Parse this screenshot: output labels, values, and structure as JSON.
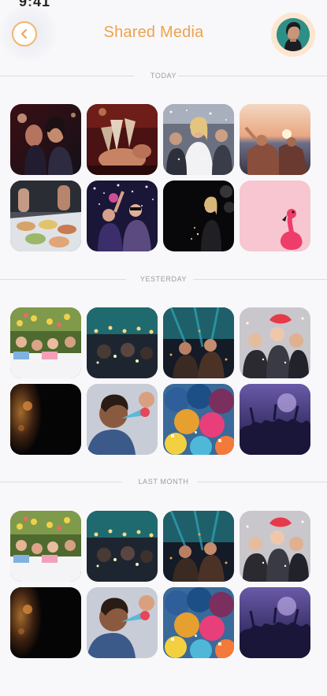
{
  "status": {
    "fragment": "9:41"
  },
  "header": {
    "title": "Shared Media",
    "back_icon": "chevron-left-icon",
    "avatar": "user-avatar",
    "accent": "#f0a24a"
  },
  "sections": [
    {
      "label": "TODAY",
      "photos": [
        "friends-toasting-night",
        "champagne-cheers",
        "crowd-dancing-confetti",
        "sunset-beach-party",
        "buffet-food-table",
        "party-lights-dancers",
        "woman-with-balloons",
        "pink-flamingo-float"
      ]
    },
    {
      "label": "YESTERDAY",
      "photos": [
        "kids-birthday-table",
        "string-lights-crowd",
        "confetti-party-friends",
        "group-selfie-confetti",
        "dark-party-closeup",
        "boy-blowing-party-horn",
        "colorful-balloons",
        "concert-crowd-purple"
      ]
    },
    {
      "label": "LAST MONTH",
      "photos": [
        "kids-birthday-table",
        "string-lights-crowd",
        "confetti-party-friends",
        "group-selfie-confetti",
        "dark-party-closeup",
        "boy-blowing-party-horn",
        "colorful-balloons",
        "concert-crowd-purple"
      ]
    }
  ]
}
